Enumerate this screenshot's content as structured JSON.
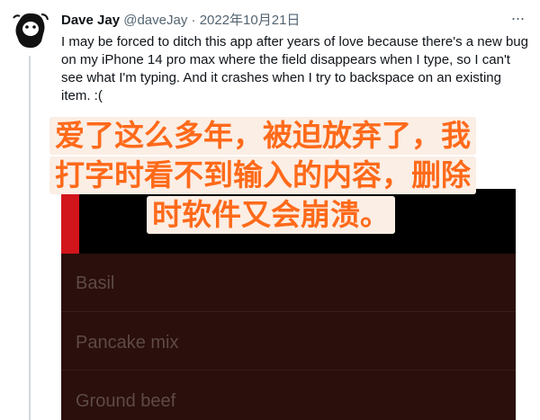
{
  "tweet": {
    "author_name": "Dave Jay",
    "author_handle": "@daveJay",
    "separator": "·",
    "date": "2022年10月21日",
    "more_label": "···",
    "text": "I may be forced to ditch this app after years of love because there's a new bug on my iPhone 14 pro max where the field disappears when I type, so I can't see what I'm typing. And it crashes when I try to backspace on an existing item. :("
  },
  "caption": {
    "line1": "爱了这么多年，被迫放弃了，我",
    "line2": "打字时看不到输入的内容，删除",
    "line3": "时软件又会崩溃。"
  },
  "app_screenshot": {
    "items": [
      "Basil",
      "Pancake mix",
      "Ground beef"
    ]
  },
  "colors": {
    "caption_text": "#ff6a1a",
    "caption_bg": "#fbeee5",
    "app_accent": "#d2141c",
    "app_list_bg": "#2a0f0c"
  }
}
